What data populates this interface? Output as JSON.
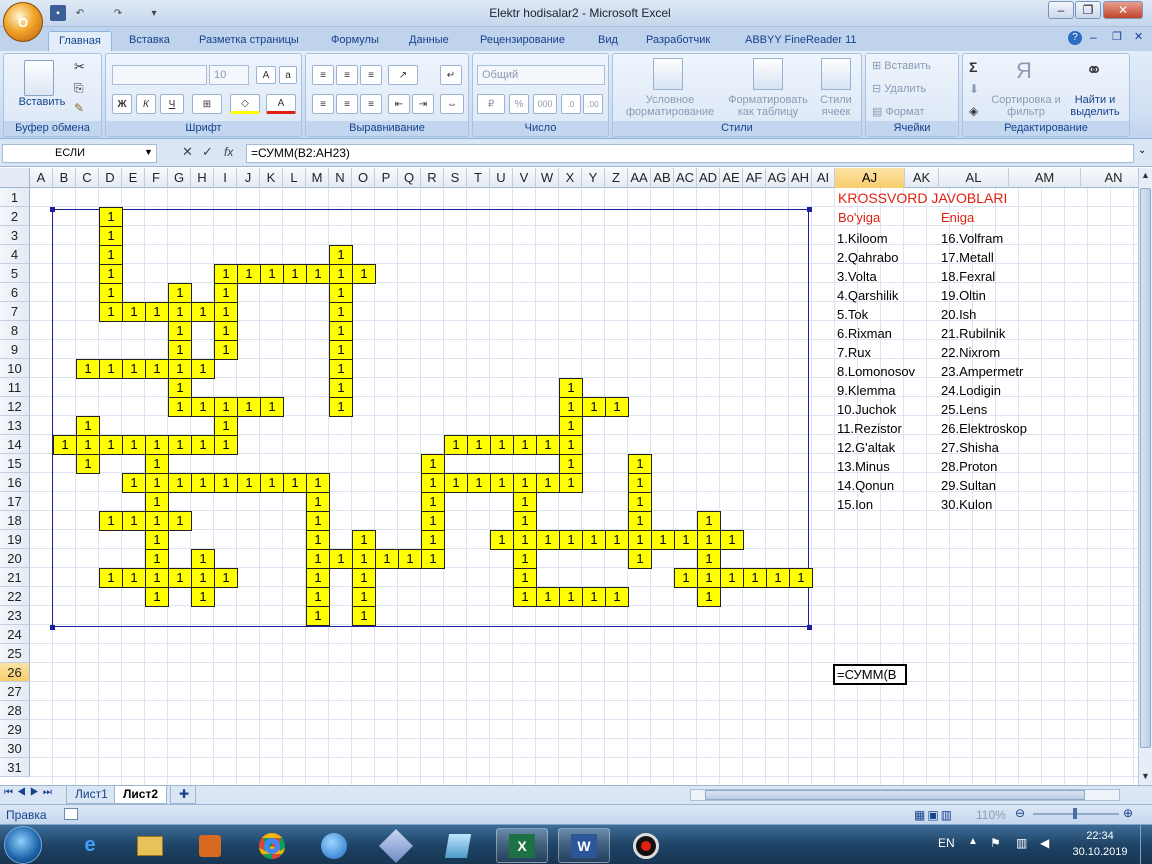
{
  "window": {
    "title": "Elektr hodisalar2 - Microsoft Excel",
    "office_button": "O"
  },
  "ribbon_tabs": [
    "Главная",
    "Вставка",
    "Разметка страницы",
    "Формулы",
    "Данные",
    "Рецензирование",
    "Вид",
    "Разработчик",
    "ABBYY FineReader 11"
  ],
  "ribbon": {
    "clipboard": {
      "label": "Буфер обмена",
      "paste": "Вставить"
    },
    "font": {
      "label": "Шрифт",
      "font_name": "",
      "font_size": "10"
    },
    "alignment": {
      "label": "Выравнивание"
    },
    "number": {
      "label": "Число",
      "format": "Общий"
    },
    "styles": {
      "label": "Стили",
      "conditional": "Условное форматирование",
      "as_table": "Форматировать как таблицу",
      "cell_styles": "Стили ячеек"
    },
    "cells": {
      "label": "Ячейки",
      "insert": "Вставить",
      "delete": "Удалить",
      "format": "Формат"
    },
    "editing": {
      "label": "Редактирование",
      "sort": "Сортировка и фильтр",
      "find": "Найти и выделить",
      "sum": "Σ"
    }
  },
  "formula_bar": {
    "name_box": "ЕСЛИ",
    "fx": "fx",
    "formula": "=СУММ(B2:AH23)"
  },
  "columns": [
    "A",
    "B",
    "C",
    "D",
    "E",
    "F",
    "G",
    "H",
    "I",
    "J",
    "K",
    "L",
    "M",
    "N",
    "O",
    "P",
    "Q",
    "R",
    "S",
    "T",
    "U",
    "V",
    "W",
    "X",
    "Y",
    "Z",
    "AA",
    "AB",
    "AC",
    "AD",
    "AE",
    "AF",
    "AG",
    "AH",
    "AI",
    "AJ",
    "AK",
    "AL",
    "AM",
    "AN"
  ],
  "rows": [
    "1",
    "2",
    "3",
    "4",
    "5",
    "6",
    "7",
    "8",
    "9",
    "10",
    "11",
    "12",
    "13",
    "14",
    "15",
    "16",
    "17",
    "18",
    "19",
    "20",
    "21",
    "22",
    "23",
    "24",
    "25",
    "26",
    "27",
    "28",
    "29",
    "30",
    "31"
  ],
  "selected_column": "AJ",
  "selected_row": "26",
  "crossword": {
    "cell_value": "1",
    "cells": {
      "2": [
        "D"
      ],
      "3": [
        "D"
      ],
      "4": [
        "D",
        "N"
      ],
      "5": [
        "D",
        "I",
        "J",
        "K",
        "L",
        "M",
        "N",
        "O"
      ],
      "6": [
        "D",
        "G",
        "I",
        "N"
      ],
      "7": [
        "D",
        "E",
        "F",
        "G",
        "H",
        "I",
        "N"
      ],
      "8": [
        "G",
        "I",
        "N"
      ],
      "9": [
        "G",
        "I",
        "N"
      ],
      "10": [
        "C",
        "D",
        "E",
        "F",
        "G",
        "H",
        "N"
      ],
      "11": [
        "G",
        "N",
        "X"
      ],
      "12": [
        "G",
        "H",
        "I",
        "J",
        "K",
        "N",
        "X",
        "Y",
        "Z"
      ],
      "13": [
        "C",
        "I",
        "X"
      ],
      "14": [
        "B",
        "C",
        "D",
        "E",
        "F",
        "G",
        "H",
        "I",
        "S",
        "T",
        "U",
        "V",
        "W",
        "X"
      ],
      "15": [
        "C",
        "F",
        "R",
        "X",
        "AA"
      ],
      "16": [
        "E",
        "F",
        "G",
        "H",
        "I",
        "J",
        "K",
        "L",
        "M",
        "R",
        "S",
        "T",
        "U",
        "V",
        "W",
        "X",
        "AA"
      ],
      "17": [
        "F",
        "M",
        "R",
        "V",
        "AA"
      ],
      "18": [
        "D",
        "E",
        "F",
        "G",
        "M",
        "R",
        "V",
        "AA",
        "AD"
      ],
      "19": [
        "F",
        "M",
        "O",
        "R",
        "U",
        "V",
        "W",
        "X",
        "Y",
        "Z",
        "AA",
        "AB",
        "AC",
        "AD",
        "AE"
      ],
      "20": [
        "F",
        "H",
        "M",
        "N",
        "O",
        "P",
        "Q",
        "R",
        "V",
        "AA",
        "AD"
      ],
      "21": [
        "D",
        "E",
        "F",
        "G",
        "H",
        "I",
        "M",
        "O",
        "V",
        "AC",
        "AD",
        "AE",
        "AF",
        "AG",
        "AH"
      ],
      "22": [
        "F",
        "H",
        "M",
        "O",
        "V",
        "W",
        "X",
        "Y",
        "Z",
        "AD"
      ],
      "23": [
        "M",
        "O"
      ]
    }
  },
  "answers": {
    "title": "KROSSVORD JAVOBLARI",
    "horizontal_header": "Bo'yiga",
    "vertical_header": "Eniga",
    "horizontal": [
      "1.Kiloom",
      "2.Qahrabo",
      "3.Volta",
      "4.Qarshilik",
      "5.Tok",
      "6.Rixman",
      "7.Rux",
      "8.Lomonosov",
      "9.Klemma",
      "10.Juchok",
      "11.Rezistor",
      "12.G'altak",
      "13.Minus",
      "14.Qonun",
      "15.Ion"
    ],
    "vertical": [
      "16.Volfram",
      "17.Metall",
      "18.Fexral",
      "19.Oltin",
      "20.Ish",
      "21.Rubilnik",
      "22.Nixrom",
      "23.Ampermetr",
      "24.Lodigin",
      "25.Lens",
      "26.Elektroskop",
      "27.Shisha",
      "28.Proton",
      "29.Sultan",
      "30.Kulon"
    ]
  },
  "active_cell_text": "=СУММ(B",
  "sheet_tabs": [
    "Лист1",
    "Лист2"
  ],
  "active_sheet": "Лист2",
  "status": {
    "mode": "Правка",
    "zoom": "110%"
  },
  "taskbar": {
    "lang": "EN",
    "time": "22:34",
    "date": "30.10.2019"
  },
  "colors": {
    "crossword_fill": "#ffff00",
    "answer_title": "#e02010",
    "selection": "#f8cd6a"
  }
}
